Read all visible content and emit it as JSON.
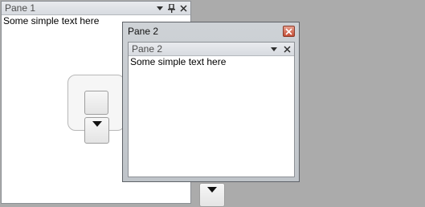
{
  "pane1": {
    "title": "Pane 1",
    "content": "Some simple text here",
    "icons": [
      "chevron-down-icon",
      "pin-icon",
      "close-icon"
    ]
  },
  "float_window": {
    "title": "Pane 2",
    "inner_pane": {
      "title": "Pane 2",
      "content": "Some simple text here",
      "icons": [
        "chevron-down-icon",
        "close-icon"
      ]
    }
  },
  "glyphs": {
    "dropdown": "▾",
    "pin": "📌",
    "close": "✕",
    "window_close": "✕"
  },
  "colors": {
    "background": "#ababab",
    "window_close": "#c44d35"
  }
}
